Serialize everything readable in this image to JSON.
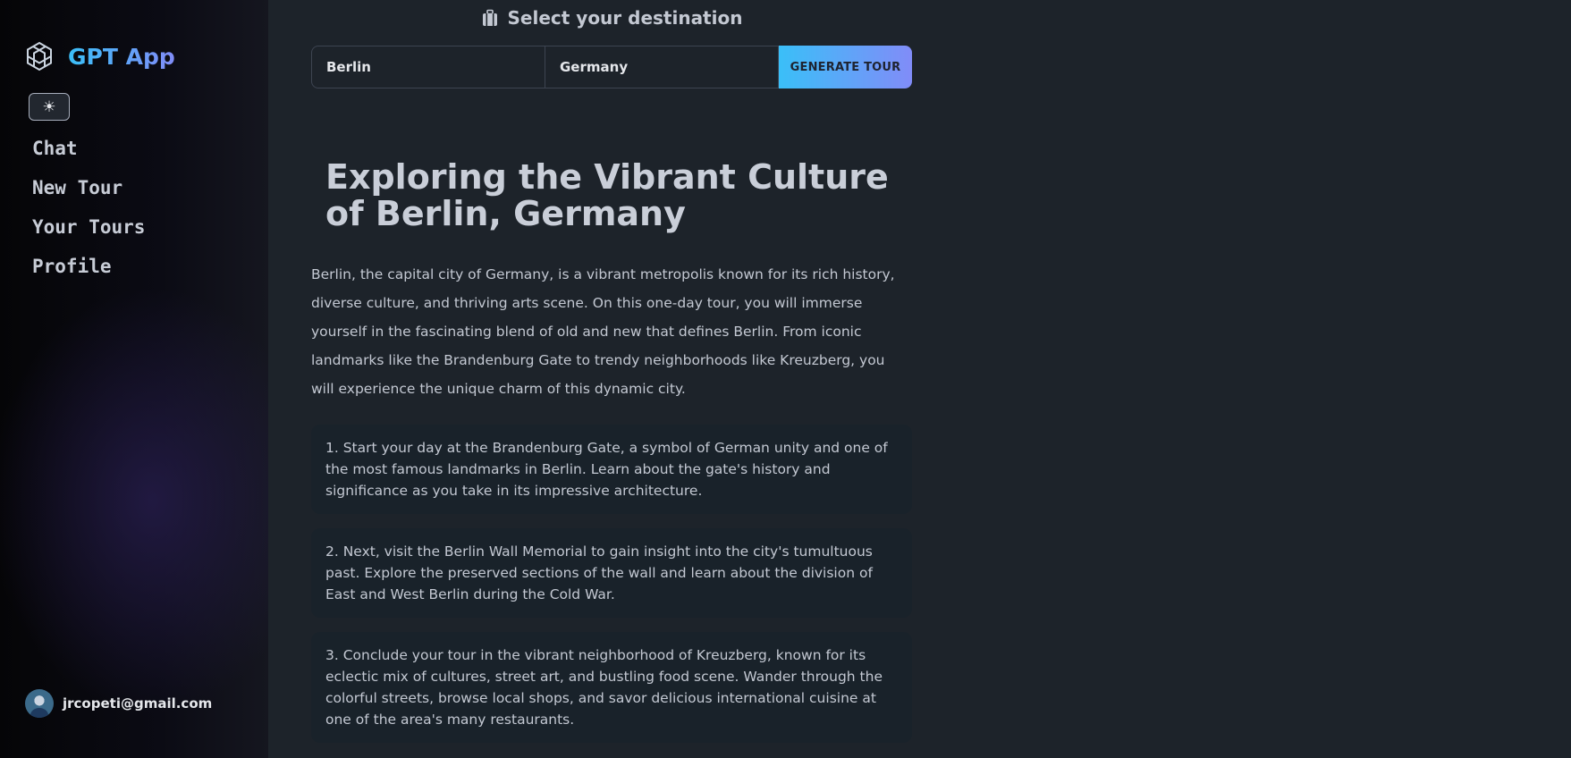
{
  "brand": {
    "name": "GPT App",
    "logo_icon": "hexagon-grid-logo-icon"
  },
  "theme_toggle": {
    "icon": "☀"
  },
  "nav": {
    "items": [
      {
        "label": "Chat"
      },
      {
        "label": "New Tour"
      },
      {
        "label": "Your Tours"
      },
      {
        "label": "Profile"
      }
    ]
  },
  "user": {
    "email": "jrcopeti@gmail.com"
  },
  "search": {
    "title": "Select your destination",
    "city_value": "Berlin",
    "country_value": "Germany",
    "submit_label": "GENERATE TOUR"
  },
  "tour": {
    "title": "Exploring the Vibrant Culture of Berlin, Germany",
    "description": "Berlin, the capital city of Germany, is a vibrant metropolis known for its rich history, diverse culture, and thriving arts scene. On this one-day tour, you will immerse yourself in the fascinating blend of old and new that defines Berlin. From iconic landmarks like the Brandenburg Gate to trendy neighborhoods like Kreuzberg, you will experience the unique charm of this dynamic city.",
    "stops": [
      "1. Start your day at the Brandenburg Gate, a symbol of German unity and one of the most famous landmarks in Berlin. Learn about the gate's history and significance as you take in its impressive architecture.",
      "2. Next, visit the Berlin Wall Memorial to gain insight into the city's tumultuous past. Explore the preserved sections of the wall and learn about the division of East and West Berlin during the Cold War.",
      "3. Conclude your tour in the vibrant neighborhood of Kreuzberg, known for its eclectic mix of cultures, street art, and bustling food scene. Wander through the colorful streets, browse local shops, and savor delicious international cuisine at one of the area's many restaurants."
    ]
  },
  "colors": {
    "accent_start": "#3abff8",
    "accent_end": "#818cf8",
    "background": "#1d232a",
    "card": "#19222a"
  }
}
